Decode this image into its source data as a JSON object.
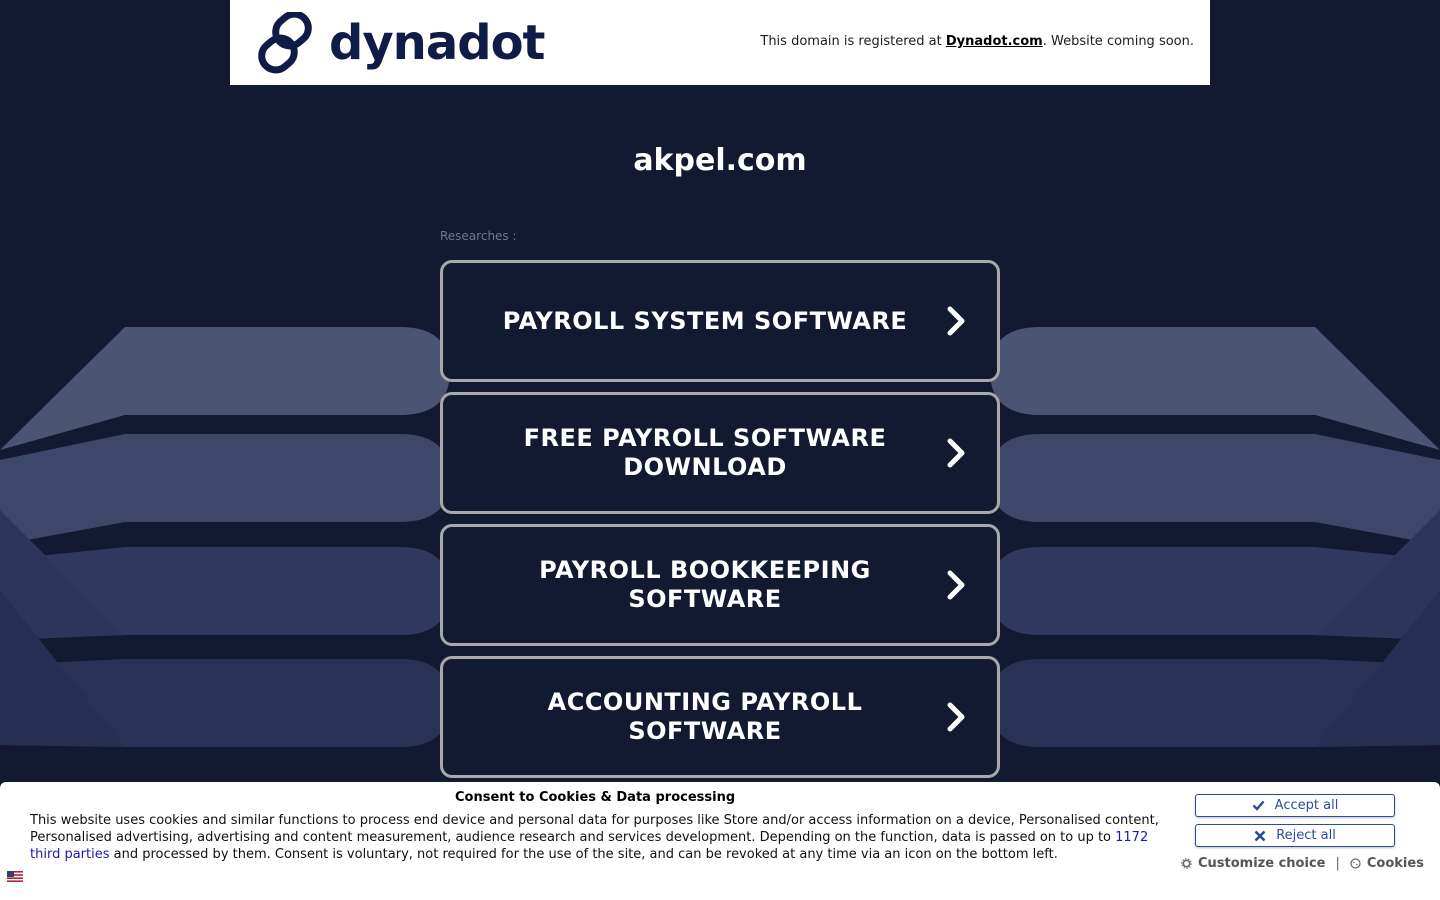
{
  "header": {
    "logo_text": "dynadot",
    "note_prefix": "This domain is registered at ",
    "note_link": "Dynadot.com",
    "note_suffix": ". Website coming soon."
  },
  "domain": "akpel.com",
  "researches_label": "Researches :",
  "links": [
    {
      "label": "PAYROLL SYSTEM SOFTWARE"
    },
    {
      "label": "FREE PAYROLL SOFTWARE DOWNLOAD"
    },
    {
      "label": "PAYROLL BOOKKEEPING SOFTWARE"
    },
    {
      "label": "ACCOUNTING PAYROLL SOFTWARE"
    }
  ],
  "cookie": {
    "title": "Consent to Cookies & Data processing",
    "text_part1": "This website uses cookies and similar functions to process end device and personal data for purposes like Store and/or access information on a device, Personalised content, Personalised advertising, advertising and content measurement, audience research and services development. Depending on the function, data is passed on to up to ",
    "third_parties_link": "1172 third parties",
    "text_part2": " and processed by them. Consent is voluntary, not required for the use of the site, and can be revoked at any time via an icon on the bottom left.",
    "accept_label": "Accept all",
    "reject_label": "Reject all",
    "customize_label": "Customize choice",
    "separator": "|",
    "cookies_label": "Cookies"
  },
  "colors": {
    "background": "#121a31",
    "brand_navy": "#0f1c46",
    "button_border": "#a8a8ab",
    "cookie_button": "#2b4c9a"
  },
  "icons": {
    "logo": "chain-link-icon",
    "link_arrow": "chevron-right-icon",
    "accept": "check-icon",
    "reject": "x-icon",
    "customize": "gear-icon",
    "cookies": "cookie-icon",
    "language": "us-flag-icon"
  }
}
